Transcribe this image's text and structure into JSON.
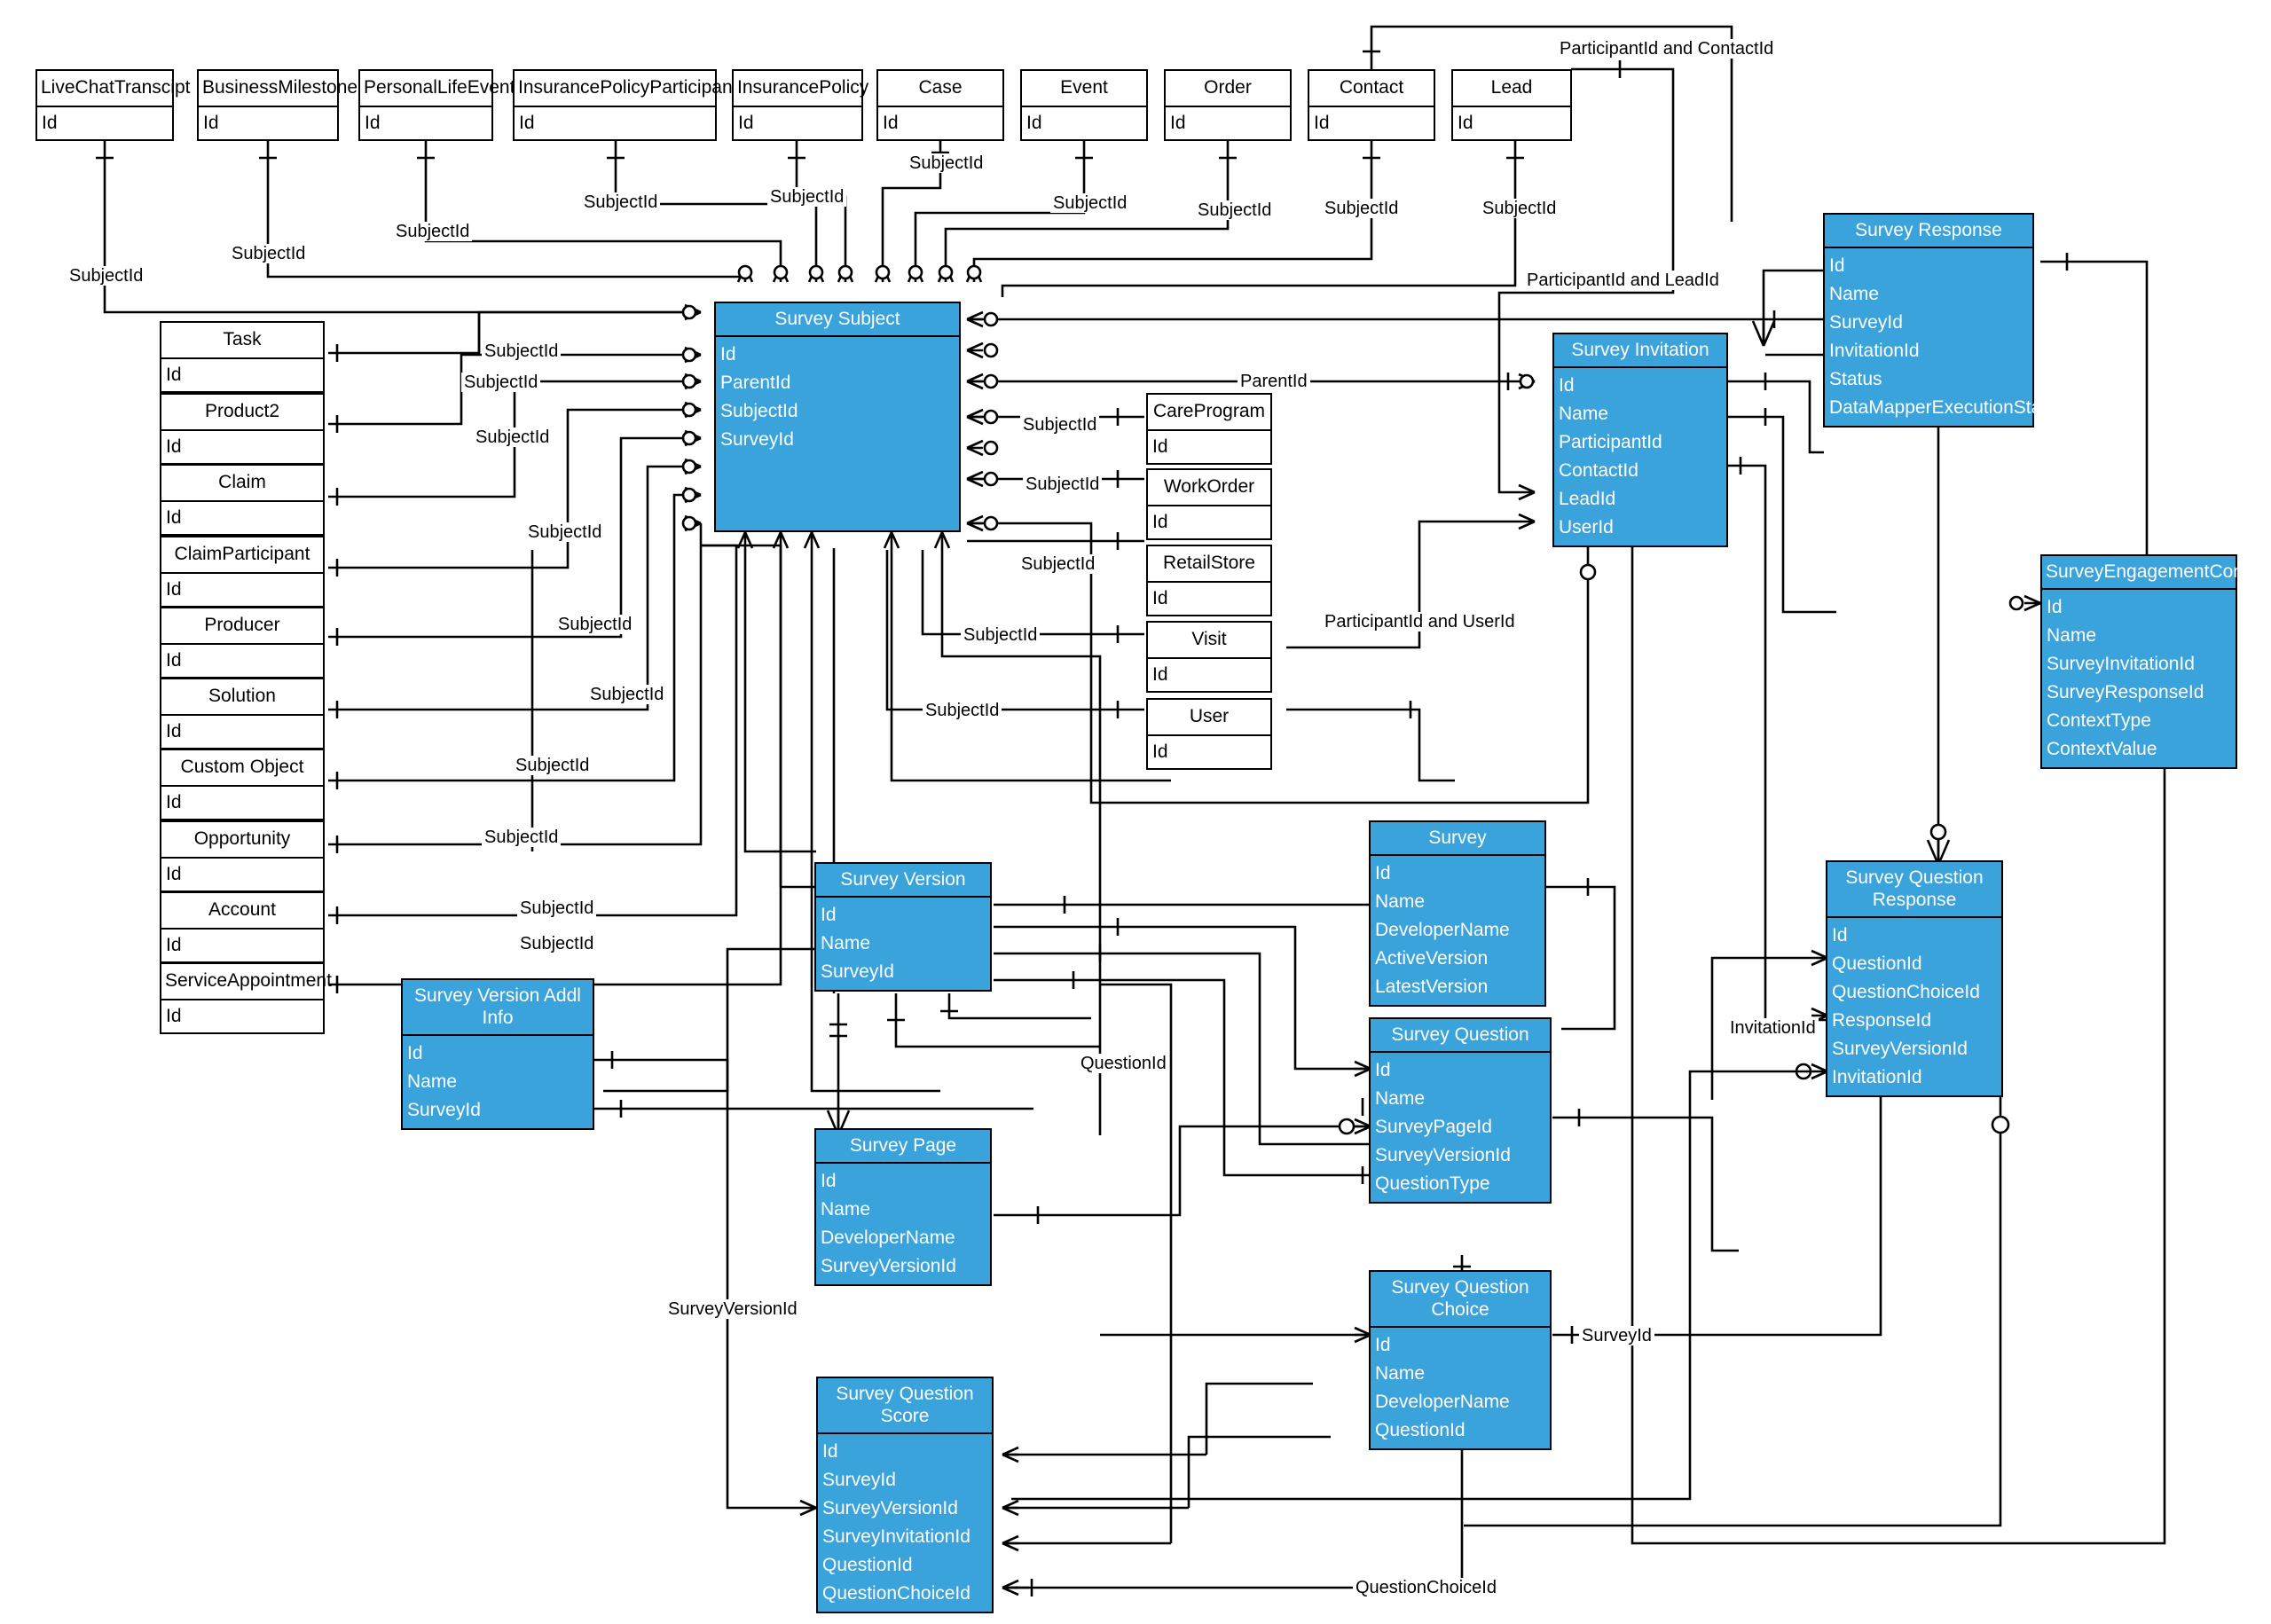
{
  "diagram": {
    "kind": "entity-relationship-diagram",
    "accent_color": "#3AA3DC",
    "line_color": "#000000",
    "background": "#FFFFFF",
    "id_attr": "Id"
  },
  "entities": {
    "live_chat_transcipt": {
      "title": "LiveChatTranscipt",
      "attrs": [
        "Id"
      ]
    },
    "business_milestone": {
      "title": "BusinessMilestone",
      "attrs": [
        "Id"
      ]
    },
    "personal_life_event": {
      "title": "PersonalLifeEvent",
      "attrs": [
        "Id"
      ]
    },
    "insurance_policy_participant": {
      "title": "InsurancePolicyParticipant",
      "attrs": [
        "Id"
      ]
    },
    "insurance_policy": {
      "title": "InsurancePolicy",
      "attrs": [
        "Id"
      ]
    },
    "case": {
      "title": "Case",
      "attrs": [
        "Id"
      ]
    },
    "event": {
      "title": "Event",
      "attrs": [
        "Id"
      ]
    },
    "order": {
      "title": "Order",
      "attrs": [
        "Id"
      ]
    },
    "contact": {
      "title": "Contact",
      "attrs": [
        "Id"
      ]
    },
    "lead": {
      "title": "Lead",
      "attrs": [
        "Id"
      ]
    },
    "task": {
      "title": "Task",
      "attrs": [
        "Id"
      ]
    },
    "product2": {
      "title": "Product2",
      "attrs": [
        "Id"
      ]
    },
    "claim": {
      "title": "Claim",
      "attrs": [
        "Id"
      ]
    },
    "claim_participant": {
      "title": "ClaimParticipant",
      "attrs": [
        "Id"
      ]
    },
    "producer": {
      "title": "Producer",
      "attrs": [
        "Id"
      ]
    },
    "solution": {
      "title": "Solution",
      "attrs": [
        "Id"
      ]
    },
    "custom_object": {
      "title": "Custom Object",
      "attrs": [
        "Id"
      ]
    },
    "opportunity": {
      "title": "Opportunity",
      "attrs": [
        "Id"
      ]
    },
    "account": {
      "title": "Account",
      "attrs": [
        "Id"
      ]
    },
    "service_appointment": {
      "title": "ServiceAppointment",
      "attrs": [
        "Id"
      ]
    },
    "care_program": {
      "title": "CareProgram",
      "attrs": [
        "Id"
      ]
    },
    "work_order": {
      "title": "WorkOrder",
      "attrs": [
        "Id"
      ]
    },
    "retail_store": {
      "title": "RetailStore",
      "attrs": [
        "Id"
      ]
    },
    "visit": {
      "title": "Visit",
      "attrs": [
        "Id"
      ]
    },
    "user": {
      "title": "User",
      "attrs": [
        "Id"
      ]
    },
    "survey_subject": {
      "title": "Survey Subject",
      "attrs": [
        "Id",
        "ParentId",
        "SubjectId",
        "SurveyId"
      ]
    },
    "survey_invitation": {
      "title": "Survey Invitation",
      "attrs": [
        "Id",
        "Name",
        "ParticipantId",
        "ContactId",
        "LeadId",
        "UserId"
      ]
    },
    "survey_response": {
      "title": "Survey Response",
      "attrs": [
        "Id",
        "Name",
        "SurveyId",
        "InvitationId",
        "Status",
        "DataMapperExecutionStatus"
      ]
    },
    "survey_engagement_context": {
      "title": "SurveyEngagementContext",
      "attrs": [
        "Id",
        "Name",
        "SurveyInvitationId",
        "SurveyResponseId",
        "ContextType",
        "ContextValue"
      ]
    },
    "survey": {
      "title": "Survey",
      "attrs": [
        "Id",
        "Name",
        "DeveloperName",
        "ActiveVersion",
        "LatestVersion"
      ]
    },
    "survey_version": {
      "title": "Survey Version",
      "attrs": [
        "Id",
        "Name",
        "SurveyId"
      ]
    },
    "survey_version_addl_info": {
      "title": "Survey Version Addl Info",
      "attrs": [
        "Id",
        "Name",
        "SurveyId"
      ]
    },
    "survey_page": {
      "title": "Survey Page",
      "attrs": [
        "Id",
        "Name",
        "DeveloperName",
        "SurveyVersionId"
      ]
    },
    "survey_question": {
      "title": "Survey Question",
      "attrs": [
        "Id",
        "Name",
        "SurveyPageId",
        "SurveyVersionId",
        "QuestionType"
      ]
    },
    "survey_question_choice": {
      "title": "Survey Question Choice",
      "attrs": [
        "Id",
        "Name",
        "DeveloperName",
        "QuestionId"
      ]
    },
    "survey_question_response": {
      "title": "Survey Question Response",
      "attrs": [
        "Id",
        "QuestionId",
        "QuestionChoiceId",
        "ResponseId",
        "SurveyVersionId",
        "InvitationId"
      ]
    },
    "survey_question_score": {
      "title": "Survey Question Score",
      "attrs": [
        "Id",
        "SurveyId",
        "SurveyVersionId",
        "SurveyInvitationId",
        "QuestionId",
        "QuestionChoiceId"
      ]
    }
  },
  "edge_labels": [
    {
      "key": "l_participant_contact",
      "text": "ParticipantId and ContactId"
    },
    {
      "key": "l_subjectid_case",
      "text": "SubjectId"
    },
    {
      "key": "l_subjectid_event",
      "text": "SubjectId"
    },
    {
      "key": "l_subjectid_order",
      "text": "SubjectId"
    },
    {
      "key": "l_subjectid_contact",
      "text": "SubjectId"
    },
    {
      "key": "l_subjectid_lead",
      "text": "SubjectId"
    },
    {
      "key": "l_subjectid_ipp",
      "text": "SubjectId"
    },
    {
      "key": "l_subjectid_ip",
      "text": "SubjectId"
    },
    {
      "key": "l_subjectid_ple",
      "text": "SubjectId"
    },
    {
      "key": "l_subjectid_bm",
      "text": "SubjectId"
    },
    {
      "key": "l_subjectid_lct",
      "text": "SubjectId"
    },
    {
      "key": "l_participant_lead",
      "text": "ParticipantId and LeadId"
    },
    {
      "key": "l_parentid",
      "text": "ParentId"
    },
    {
      "key": "l_subjectid_task",
      "text": "SubjectId"
    },
    {
      "key": "l_subjectid_product2",
      "text": "SubjectId"
    },
    {
      "key": "l_subjectid_claim",
      "text": "SubjectId"
    },
    {
      "key": "l_subjectid_claimpart",
      "text": "SubjectId"
    },
    {
      "key": "l_subjectid_producer",
      "text": "SubjectId"
    },
    {
      "key": "l_subjectid_solution",
      "text": "SubjectId"
    },
    {
      "key": "l_subjectid_custom",
      "text": "SubjectId"
    },
    {
      "key": "l_subjectid_opportunity",
      "text": "SubjectId"
    },
    {
      "key": "l_subjectid_account",
      "text": "SubjectId"
    },
    {
      "key": "l_subjectid_svcappt",
      "text": "SubjectId"
    },
    {
      "key": "l_subjectid_careprogram",
      "text": "SubjectId"
    },
    {
      "key": "l_subjectid_workorder",
      "text": "SubjectId"
    },
    {
      "key": "l_subjectid_retailstore",
      "text": "SubjectId"
    },
    {
      "key": "l_subjectid_visit",
      "text": "SubjectId"
    },
    {
      "key": "l_subjectid_user",
      "text": "SubjectId"
    },
    {
      "key": "l_participant_user",
      "text": "ParticipantId and UserId"
    },
    {
      "key": "l_questionid",
      "text": "QuestionId"
    },
    {
      "key": "l_invitationid",
      "text": "InvitationId"
    },
    {
      "key": "l_surveyversionid",
      "text": "SurveyVersionId"
    },
    {
      "key": "l_surveyid_sqc",
      "text": "SurveyId"
    },
    {
      "key": "l_questionchoiceid",
      "text": "QuestionChoiceId"
    }
  ]
}
